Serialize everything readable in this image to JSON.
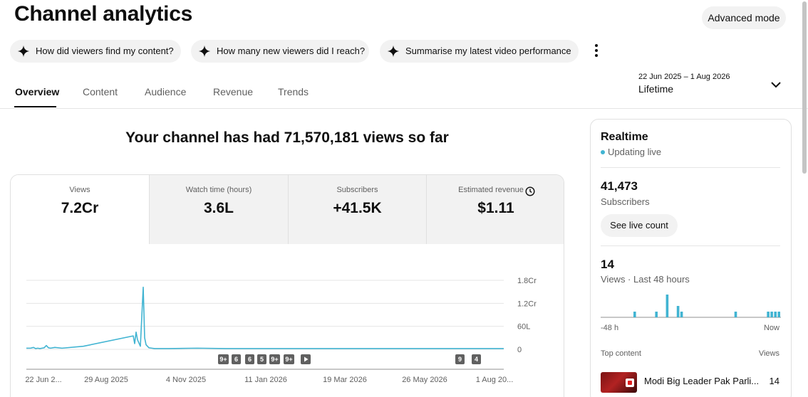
{
  "header": {
    "title": "Channel analytics",
    "advanced_mode_label": "Advanced mode"
  },
  "suggestions": [
    {
      "label": "How did viewers find my content?",
      "icon": "sparkle-icon"
    },
    {
      "label": "How many new viewers did I reach?",
      "icon": "sparkle-icon"
    },
    {
      "label": "Summarise my latest video performance",
      "icon": "sparkle-icon"
    }
  ],
  "tabs": [
    {
      "label": "Overview",
      "active": true
    },
    {
      "label": "Content",
      "active": false
    },
    {
      "label": "Audience",
      "active": false
    },
    {
      "label": "Revenue",
      "active": false
    },
    {
      "label": "Trends",
      "active": false
    }
  ],
  "date_picker": {
    "range": "22 Jun 2025 – 1 Aug 2026",
    "preset": "Lifetime"
  },
  "headline": "Your channel has had 71,570,181 views so far",
  "metrics": [
    {
      "label": "Views",
      "value": "7.2Cr",
      "active": true
    },
    {
      "label": "Watch time (hours)",
      "value": "3.6L",
      "active": false
    },
    {
      "label": "Subscribers",
      "value": "+41.5K",
      "active": false
    },
    {
      "label": "Estimated revenue",
      "value": "$1.11",
      "active": false,
      "icon": "clock-icon"
    }
  ],
  "chart_data": {
    "type": "line",
    "series": [
      {
        "values": [
          0.03,
          0.03,
          0.05,
          0.02,
          0.03,
          0.02,
          0.03,
          0.04,
          0.1,
          0.04,
          0.03,
          0.05,
          0.03,
          0.08,
          0.35,
          0.15,
          0.45,
          0.25,
          0.08,
          1.62,
          0.3,
          0.12,
          0.04,
          0.03,
          0.02,
          0.02,
          0.03,
          0.02,
          0.02,
          0.02,
          0.02,
          0.02,
          0.02,
          0.02,
          0.02,
          0.02,
          0.02,
          0.02,
          0.02,
          0.02,
          0.02,
          0.02,
          0.02,
          0.02
        ]
      }
    ],
    "x_tick_labels": [
      "22 Jun 2...",
      "29 Aug 2025",
      "4 Nov 2025",
      "11 Jan 2026",
      "19 Mar 2026",
      "26 May 2026",
      "1 Aug 20..."
    ],
    "y_tick_labels": [
      "1.8Cr",
      "1.2Cr",
      "60L",
      "0"
    ],
    "ylim_cr": [
      0,
      1.8
    ],
    "color": "#41b4d2",
    "grid": true,
    "markers": [
      "9+",
      "6",
      "6",
      "5",
      "9+",
      "9+",
      "play-icon",
      "9",
      "4"
    ]
  },
  "realtime": {
    "title": "Realtime",
    "status": "Updating live",
    "subscribers_value": "41,473",
    "subscribers_label": "Subscribers",
    "live_count_label": "See live count",
    "views_value": "14",
    "views_label": "Views · Last 48 hours",
    "bars": [
      0,
      0,
      0,
      0,
      0,
      0,
      0,
      0,
      0,
      1,
      0,
      0,
      0,
      0,
      0,
      1,
      0,
      0,
      4,
      0,
      0,
      2,
      1,
      0,
      0,
      0,
      0,
      0,
      0,
      0,
      0,
      0,
      0,
      0,
      0,
      0,
      0,
      1,
      0,
      0,
      0,
      0,
      0,
      0,
      0,
      0,
      1,
      1,
      1,
      1
    ],
    "bar_color": "#41b4d2",
    "axis_left": "-48 h",
    "axis_right": "Now",
    "top_content_label": "Top content",
    "views_col_label": "Views",
    "top_items": [
      {
        "title": "Modi Big Leader Pak Parli...",
        "views": "14"
      }
    ]
  }
}
